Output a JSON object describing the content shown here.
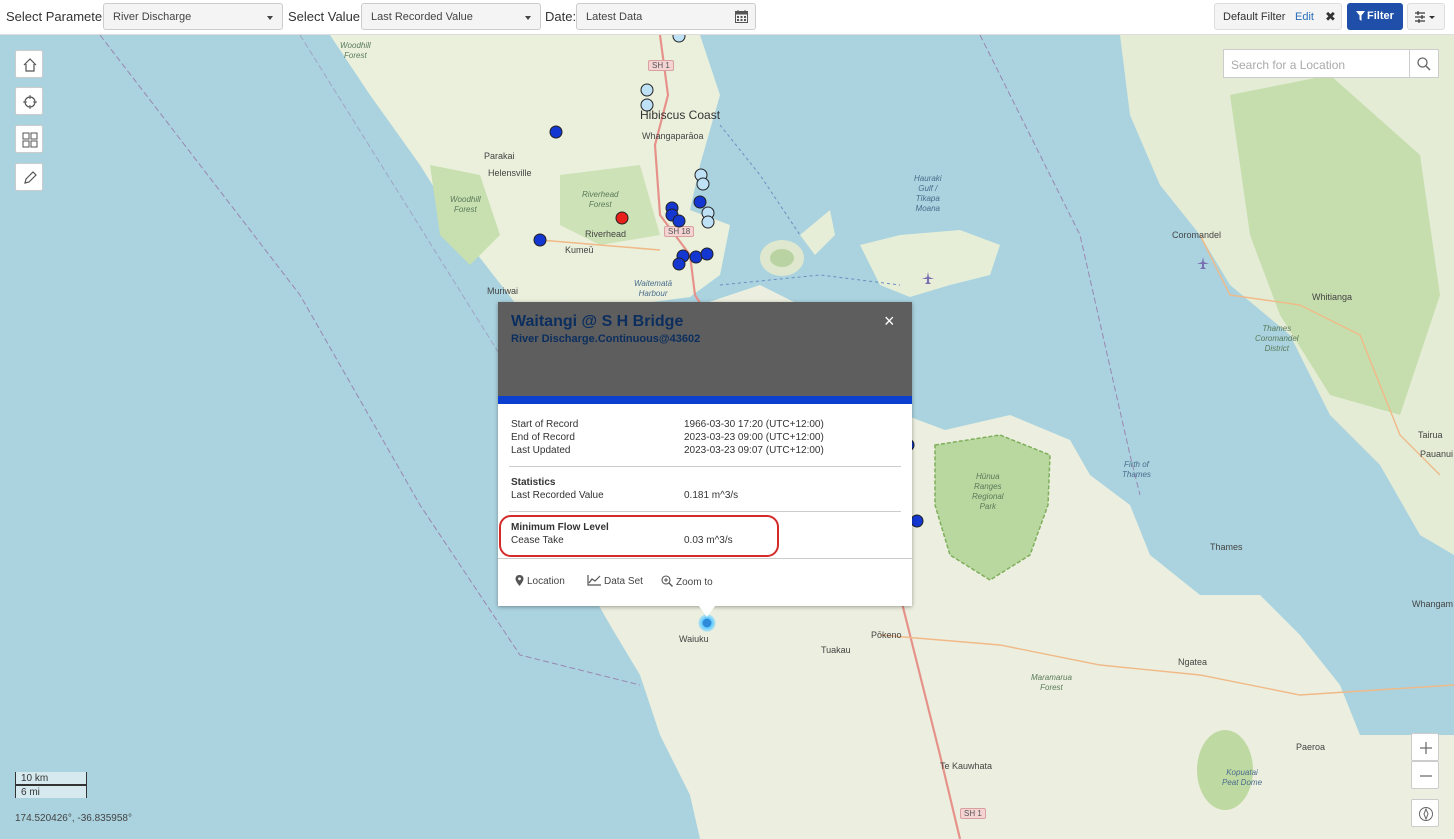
{
  "toolbar": {
    "param_label": "Select Parameter:",
    "param_value": "River Discharge",
    "value_label": "Select Value:",
    "value_value": "Last Recorded Value",
    "date_label": "Date:",
    "date_value": "Latest Data",
    "default_filter": "Default Filter",
    "edit": "Edit",
    "clear": "✖",
    "filter_button": "Filter"
  },
  "search": {
    "placeholder": "Search for a Location"
  },
  "map": {
    "places": {
      "woodhill_top": "Woodhill\nForest",
      "hibiscus_coast": "Hibiscus Coast",
      "whangaparaoa": "Whangaparāoa",
      "parakai": "Parakai",
      "helensville": "Helensville",
      "riverhead_forest": "Riverhead\nForest",
      "woodhill_forest": "Woodhill\nForest",
      "riverhead": "Riverhead",
      "kumeu": "Kumeū",
      "muriwai": "Muriwai",
      "waitemata": "Waitematā\nHarbour",
      "hauraki_gulf": "Hauraki\nGulf /\nTīkapa\nMoana",
      "coromandel": "Coromandel",
      "whitianga": "Whitianga",
      "thames_coromandel": "Thames\nCoromandel\nDistrict",
      "tairua": "Tairua",
      "pauanui": "Pauanui",
      "firth_of_thames": "Firth of\nThames",
      "hunua": "Hūnua\nRanges\nRegional\nPark",
      "thames": "Thames",
      "whangamata": "Whangam",
      "waiuku": "Waiuku",
      "pokeno": "Pōkeno",
      "tuakau": "Tuakau",
      "ngatea": "Ngatea",
      "maramarua": "Maramarua\nForest",
      "paeroa": "Paeroa",
      "te_kauwhata": "Te Kauwhata",
      "kopuatai": "Kopuatai\nPeat Dome"
    },
    "shields": {
      "sh1_top": "SH 1",
      "sh18": "SH 18",
      "sh1_bottom": "SH 1"
    },
    "scale_km": "10 km",
    "scale_mi": "6 mi",
    "coordinates": "174.520426°, -36.835958°"
  },
  "popup": {
    "title": "Waitangi @ S H Bridge",
    "subtitle": "River Discharge.Continuous@43602",
    "close": "×",
    "start_label": "Start of Record",
    "start_value": "1966-03-30 17:20 (UTC+12:00)",
    "end_label": "End of Record",
    "end_value": "2023-03-23 09:00 (UTC+12:00)",
    "updated_label": "Last Updated",
    "updated_value": "2023-03-23 09:07 (UTC+12:00)",
    "stats_heading": "Statistics",
    "last_value_label": "Last Recorded Value",
    "last_value": "0.181 m^3/s",
    "min_flow_heading": "Minimum Flow Level",
    "cease_take_label": "Cease Take",
    "cease_take_value": "0.03 m^3/s",
    "actions": {
      "location": "Location",
      "dataset": "Data Set",
      "zoom": "Zoom to"
    }
  },
  "colors": {
    "marker_dark": "#1437d1",
    "marker_light": "#bfe1f6",
    "marker_red": "#e8201b",
    "accent": "#1f4fa8",
    "popup_header": "#5e5e5e",
    "popup_title": "#0b2e5e",
    "highlight_outline": "#d42a2a",
    "sea": "#aad3df"
  }
}
